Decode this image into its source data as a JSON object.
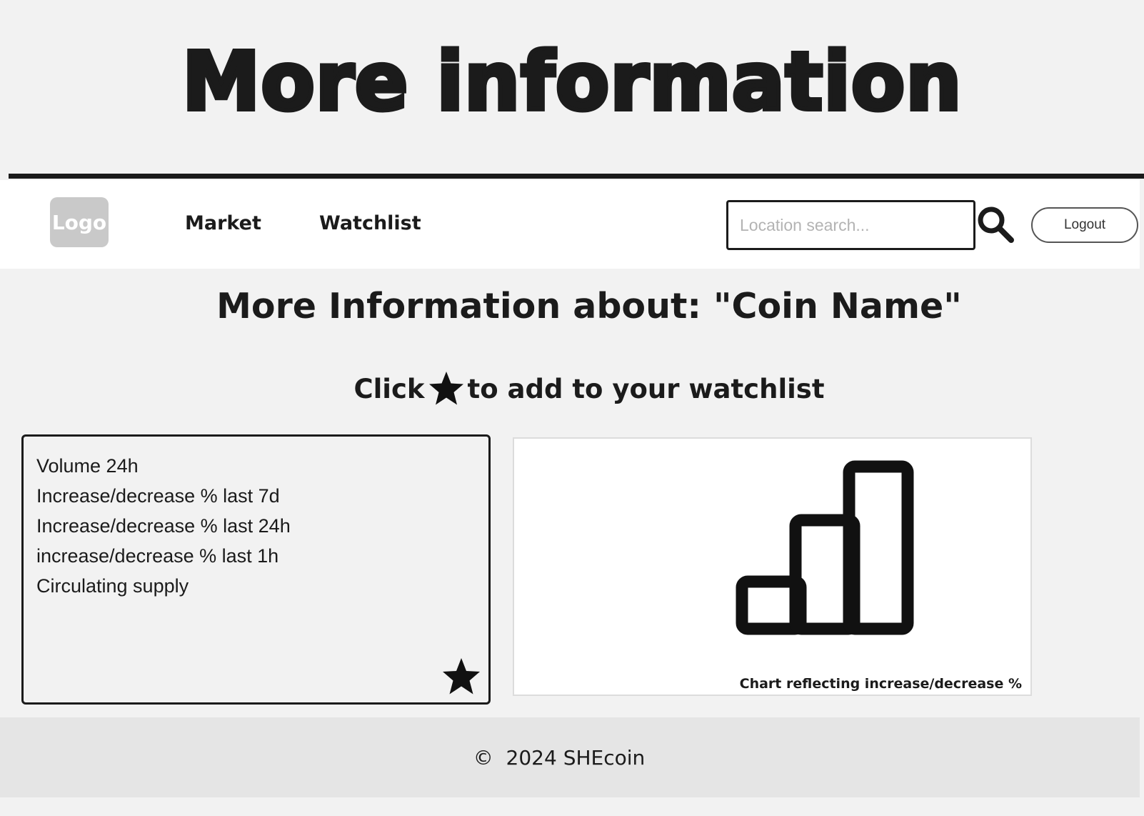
{
  "banner": {
    "title": "More information"
  },
  "nav": {
    "logo": "Logo",
    "links": [
      "Market",
      "Watchlist"
    ],
    "search_placeholder": "Location search...",
    "logout_label": "Logout"
  },
  "main": {
    "title": "More Information about: \"Coin Name\"",
    "subtitle_before": "Click",
    "subtitle_after": "to add to your watchlist"
  },
  "info_card": {
    "items": [
      "Volume 24h",
      "Increase/decrease % last 7d",
      "Increase/decrease % last 24h",
      "increase/decrease % last 1h",
      "Circulating supply"
    ]
  },
  "chart_panel": {
    "caption": "Chart reflecting increase/decrease %"
  },
  "footer": {
    "text": "©  2024 SHEcoin"
  },
  "icons": {
    "search": "search-icon",
    "star": "star-icon",
    "chart": "bar-chart-icon"
  }
}
